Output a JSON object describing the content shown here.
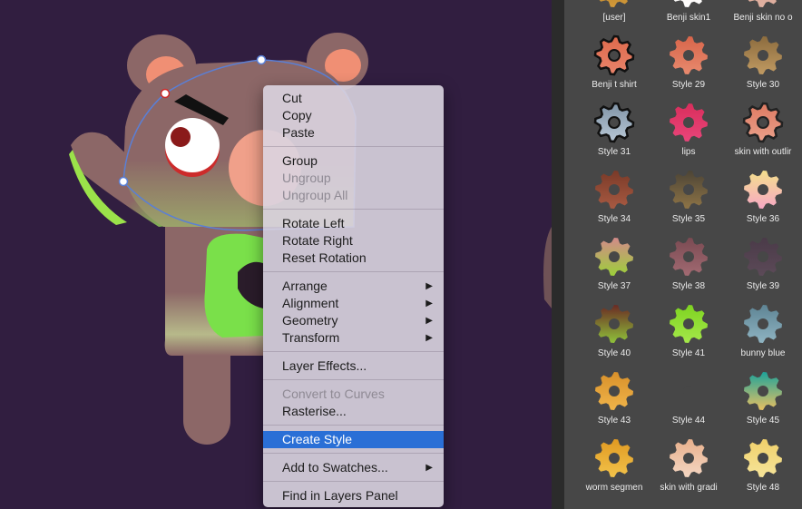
{
  "context_menu": {
    "items": [
      {
        "label": "Cut",
        "enabled": true
      },
      {
        "label": "Copy",
        "enabled": true
      },
      {
        "label": "Paste",
        "enabled": true
      },
      {
        "label": "Group",
        "enabled": true
      },
      {
        "label": "Ungroup",
        "enabled": false
      },
      {
        "label": "Ungroup All",
        "enabled": false
      },
      {
        "label": "Rotate Left",
        "enabled": true
      },
      {
        "label": "Rotate Right",
        "enabled": true
      },
      {
        "label": "Reset Rotation",
        "enabled": true
      },
      {
        "label": "Arrange",
        "enabled": true,
        "submenu": true
      },
      {
        "label": "Alignment",
        "enabled": true,
        "submenu": true
      },
      {
        "label": "Geometry",
        "enabled": true,
        "submenu": true
      },
      {
        "label": "Transform",
        "enabled": true,
        "submenu": true
      },
      {
        "label": "Layer Effects...",
        "enabled": true
      },
      {
        "label": "Convert to Curves",
        "enabled": false
      },
      {
        "label": "Rasterise...",
        "enabled": true
      },
      {
        "label": "Create Style",
        "enabled": true,
        "highlighted": true
      },
      {
        "label": "Add to Swatches...",
        "enabled": true,
        "submenu": true
      },
      {
        "label": "Find in Layers Panel",
        "enabled": true
      }
    ],
    "submenu_arrow": "▶"
  },
  "styles_panel": {
    "styles": [
      {
        "label": "[user]",
        "colors": [
          "#a0701f",
          "#d49a3a"
        ]
      },
      {
        "label": "Benji skin1",
        "colors": [
          "#f0e6dc",
          "#ffffff"
        ]
      },
      {
        "label": "Benji skin no o",
        "colors": [
          "#c89282",
          "#e2b3a3"
        ]
      },
      {
        "label": "Benji t shirt",
        "colors": [
          "#de6a4c",
          "#e8836a"
        ],
        "outline": "#111111"
      },
      {
        "label": "Style 29",
        "colors": [
          "#d8654a",
          "#e88a6e"
        ]
      },
      {
        "label": "Style 30",
        "colors": [
          "#8c6c3e",
          "#c09a62"
        ]
      },
      {
        "label": "Style 31",
        "colors": [
          "#7f93a6",
          "#b9c8d6"
        ],
        "outline": "#111111"
      },
      {
        "label": "lips",
        "colors": [
          "#d92e5c",
          "#e8457a"
        ]
      },
      {
        "label": "skin with outlir",
        "colors": [
          "#de7a62",
          "#eaa08a"
        ],
        "outline": "#222222"
      },
      {
        "label": "Style 34",
        "colors": [
          "#7a3a28",
          "#a85a42"
        ]
      },
      {
        "label": "Style 35",
        "colors": [
          "#4c4436",
          "#8e7446"
        ]
      },
      {
        "label": "Style 36",
        "colors": [
          "#f4e08c",
          "#f7a8c4"
        ]
      },
      {
        "label": "Style 37",
        "colors": [
          "#d38a8a",
          "#9ccf3a"
        ]
      },
      {
        "label": "Style 38",
        "colors": [
          "#7a4a52",
          "#a26a72"
        ]
      },
      {
        "label": "Style 39",
        "colors": [
          "#4a3a48",
          "#5c4a58"
        ]
      },
      {
        "label": "Style 40",
        "colors": [
          "#6a2a24",
          "#8fc23a"
        ]
      },
      {
        "label": "Style 41",
        "colors": [
          "#7ed321",
          "#a5e84a"
        ]
      },
      {
        "label": "bunny blue",
        "colors": [
          "#5e8494",
          "#8fb4c2"
        ]
      },
      {
        "label": "Style 43",
        "colors": [
          "#d8902a",
          "#f0b44a"
        ]
      },
      {
        "label": "Style 44",
        "colors": [
          "#474747",
          "#474747"
        ]
      },
      {
        "label": "Style 45",
        "colors": [
          "#1ea39a",
          "#e7c062"
        ]
      },
      {
        "label": "worm segmen",
        "colors": [
          "#e09a22",
          "#f2c24a"
        ]
      },
      {
        "label": "skin with gradi",
        "colors": [
          "#e8b08c",
          "#f4d6c2"
        ]
      },
      {
        "label": "Style 48",
        "colors": [
          "#f0d06a",
          "#f6e49a"
        ]
      }
    ]
  },
  "canvas": {
    "background": "#311e40",
    "accent_fur": "#8c6767",
    "accent_green": "#7ae04a",
    "selection_color": "#5a7fd6"
  }
}
